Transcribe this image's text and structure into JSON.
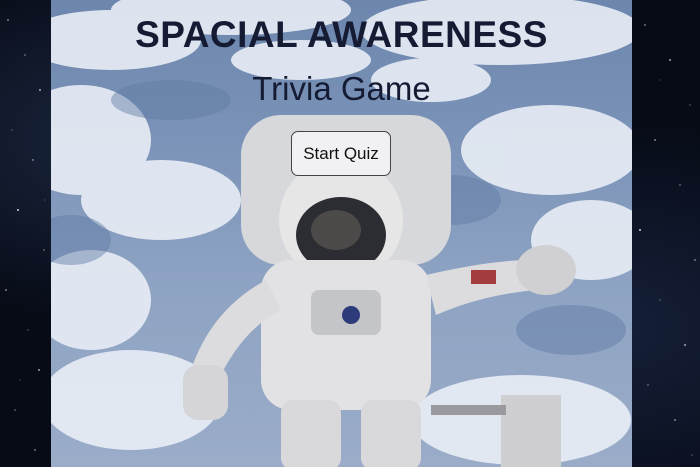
{
  "page": {
    "title": "SPACIAL AWARENESS",
    "subtitle": "Trivia Game",
    "start_button_label": "Start Quiz"
  },
  "background": {
    "panel_image": "astronaut-spacewalk-over-clouds",
    "side_image": "starfield"
  },
  "colors": {
    "title_text": "#141b33",
    "button_bg": "#f1f1f3",
    "space_bg": "#070b16"
  }
}
